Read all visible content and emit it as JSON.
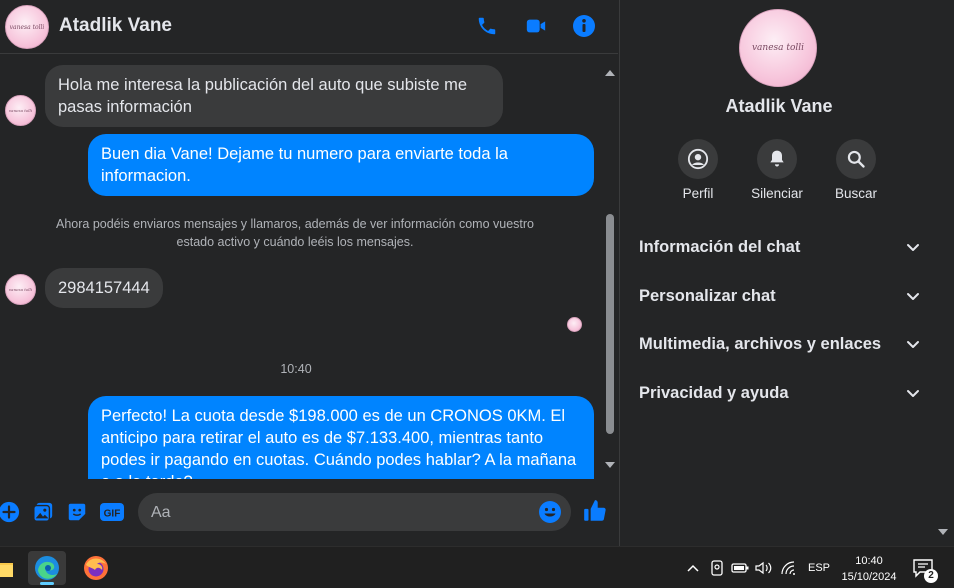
{
  "chat": {
    "contact_name": "Atadlik Vane",
    "avatar_text": "vanesa tolli"
  },
  "messages": [
    {
      "dir": "in",
      "text": "Hola me interesa la publicación del auto que subiste me pasas información"
    },
    {
      "dir": "out",
      "text": "Buen dia Vane! Dejame tu numero para enviarte toda la informacion."
    },
    {
      "dir": "system",
      "text": "Ahora podéis enviaros mensajes y llamaros, además de ver información como vuestro estado activo y cuándo leéis los mensajes."
    },
    {
      "dir": "in",
      "text": "2984157444"
    },
    {
      "dir": "time",
      "text": "10:40"
    },
    {
      "dir": "out",
      "text": "Perfecto! La cuota desde $198.000 es de un CRONOS 0KM. El anticipo para retirar el auto es de $7.133.400, mientras tanto podes ir pagando en cuotas. Cuándo podes hablar? A la mañana o a la tarde?"
    }
  ],
  "composer": {
    "placeholder": "Aa",
    "gif_label": "GIF"
  },
  "panel": {
    "name": "Atadlik Vane",
    "actions": [
      {
        "label": "Perfil",
        "icon": "profile-icon"
      },
      {
        "label": "Silenciar",
        "icon": "bell-icon"
      },
      {
        "label": "Buscar",
        "icon": "search-icon"
      }
    ],
    "sections": [
      "Información del chat",
      "Personalizar chat",
      "Multimedia, archivos y enlaces",
      "Privacidad y ayuda"
    ]
  },
  "taskbar": {
    "language": "ESP",
    "time": "10:40",
    "date": "15/10/2024",
    "notification_count": "2"
  },
  "colors": {
    "accent": "#0a7cff",
    "outgoing_bubble": "#0084ff",
    "incoming_bubble": "#3a3b3c",
    "background": "#242526"
  }
}
